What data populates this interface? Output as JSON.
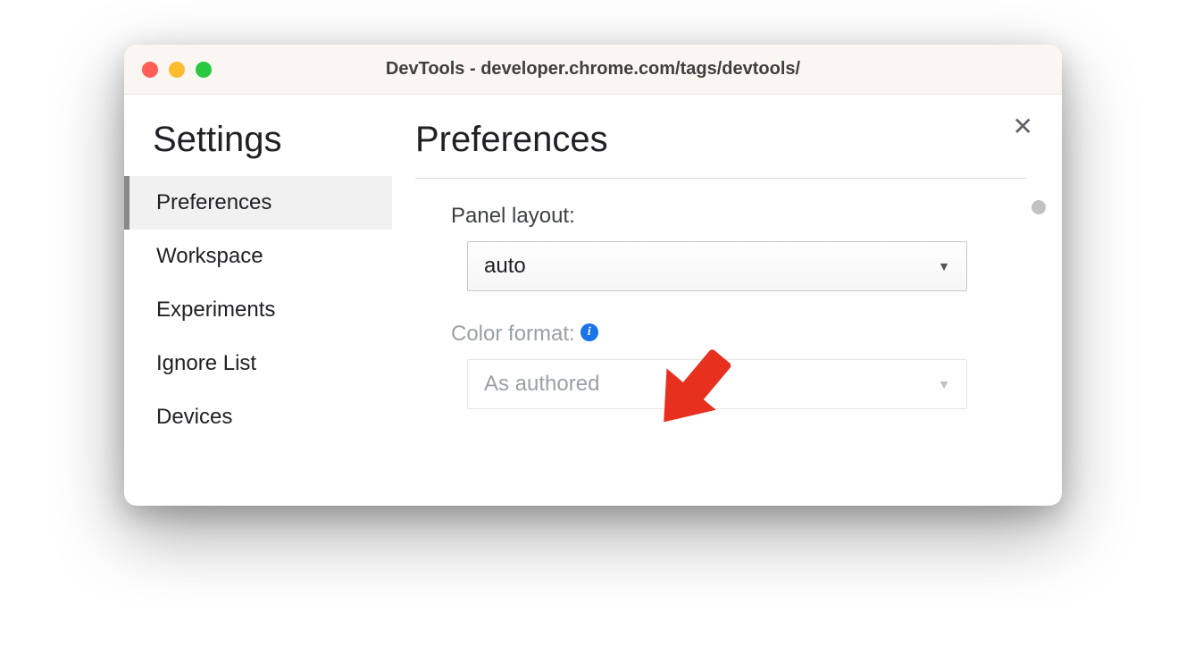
{
  "window": {
    "title": "DevTools - developer.chrome.com/tags/devtools/"
  },
  "sidebar": {
    "title": "Settings",
    "items": [
      {
        "label": "Preferences",
        "active": true
      },
      {
        "label": "Workspace",
        "active": false
      },
      {
        "label": "Experiments",
        "active": false
      },
      {
        "label": "Ignore List",
        "active": false
      },
      {
        "label": "Devices",
        "active": false
      }
    ]
  },
  "main": {
    "title": "Preferences",
    "fields": {
      "panel_layout": {
        "label": "Panel layout:",
        "value": "auto"
      },
      "color_format": {
        "label": "Color format:",
        "value": "As authored",
        "disabled": true,
        "has_info_icon": true
      }
    }
  },
  "annotation": {
    "arrow_color": "#e8301f"
  }
}
